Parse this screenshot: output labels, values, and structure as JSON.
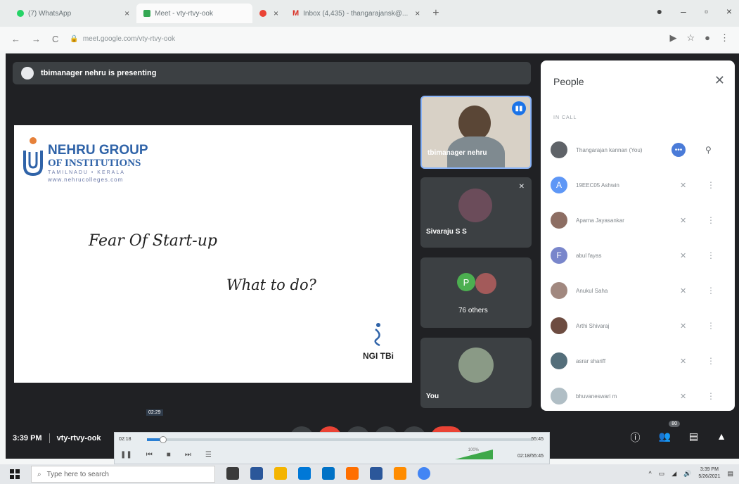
{
  "browser": {
    "tabs": [
      {
        "label": "(7) WhatsApp",
        "color": "#25d366",
        "active": false
      },
      {
        "label": "Meet - vty-rtvy-ook",
        "color": "#34a853",
        "active": true
      },
      {
        "label": "",
        "color": "#ea4335",
        "active": false
      },
      {
        "label": "Inbox (4,435) - thangarajansk@...",
        "color": "#d93025",
        "active": false
      }
    ],
    "url": "meet.google.com/vty-rtvy-ook"
  },
  "meet": {
    "presenting_text": "tbimanager nehru is presenting",
    "meeting_code": "vty-rtvy-ook",
    "time": "3:39 PM",
    "people_badge": "80"
  },
  "slide": {
    "org_title": "NEHRU GROUP",
    "org_sub": "OF INSTITUTIONS",
    "org_location": "TAMILNADU • KERALA",
    "org_web": "www.nehrucolleges.com",
    "heading1": "Fear Of Start-up",
    "heading2": "What to do?",
    "brand": "NGI TBi"
  },
  "tiles": {
    "t1_label": "tbimanager nehru",
    "t2_label": "Sivaraju S S",
    "t3_label": "76 others",
    "t3_initial": "P",
    "t4_label": "You"
  },
  "people": {
    "title": "People",
    "section": "IN CALL",
    "list": [
      {
        "name": "Thangarajan kannan (You)",
        "initial": "",
        "color": "#5f6368"
      },
      {
        "name": "19EEC05 Ashwin",
        "initial": "A",
        "color": "#5e97f6"
      },
      {
        "name": "Aparna Jayasankar",
        "initial": "",
        "color": "#8d6e63"
      },
      {
        "name": "abul fayas",
        "initial": "F",
        "color": "#7986cb"
      },
      {
        "name": "Anukul Saha",
        "initial": "",
        "color": "#a1887f"
      },
      {
        "name": "Arthi Shivaraj",
        "initial": "",
        "color": "#6d4c41"
      },
      {
        "name": "asrar shariff",
        "initial": "",
        "color": "#546e7a"
      },
      {
        "name": "bhuvaneswari m",
        "initial": "",
        "color": "#b0bec5"
      }
    ]
  },
  "player": {
    "current": "02:18",
    "tooltip": "02:29",
    "total": "55:45",
    "timecode": "02:18/55:45",
    "volume": "100%",
    "progress": 0.042
  },
  "taskbar": {
    "search_placeholder": "Type here to search",
    "clock_time": "3:39 PM",
    "clock_date": "5/26/2021"
  }
}
